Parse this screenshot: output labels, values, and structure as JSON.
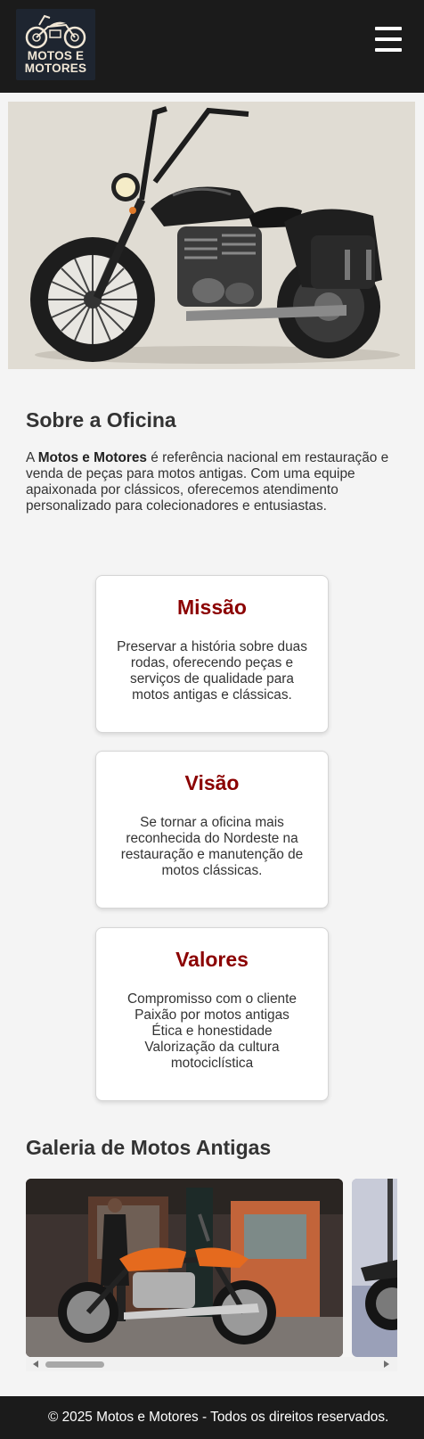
{
  "header": {
    "logo_line1": "MOTOS E",
    "logo_line2": "MOTORES",
    "menu_icon": "hamburger-menu-icon"
  },
  "about": {
    "title": "Sobre a Oficina",
    "text_prefix": "A ",
    "brand": "Motos e Motores",
    "text_rest": " é referência nacional em restauração e venda de peças para motos antigas. Com uma equipe apaixonada por clássicos, oferecemos atendimento personalizado para colecionadores e entusiastas."
  },
  "cards": {
    "mission": {
      "title": "Missão",
      "text": "Preservar a história sobre duas rodas, oferecendo peças e serviços de qualidade para motos antigas e clássicas."
    },
    "vision": {
      "title": "Visão",
      "text": "Se tornar a oficina mais reconhecida do Nordeste na restauração e manutenção de motos clássicas."
    },
    "values": {
      "title": "Valores",
      "items": [
        "Compromisso com o cliente",
        "Paixão por motos antigas",
        "Ética e honestidade",
        "Valorização da cultura motociclística"
      ]
    }
  },
  "gallery": {
    "title": "Galeria de Motos Antigas"
  },
  "footer": {
    "text": "© 2025 Motos e Motores - Todos os direitos reservados."
  },
  "colors": {
    "header_bg": "#1b1b1b",
    "accent": "#8b0000",
    "page_bg": "#f4f4f4"
  }
}
